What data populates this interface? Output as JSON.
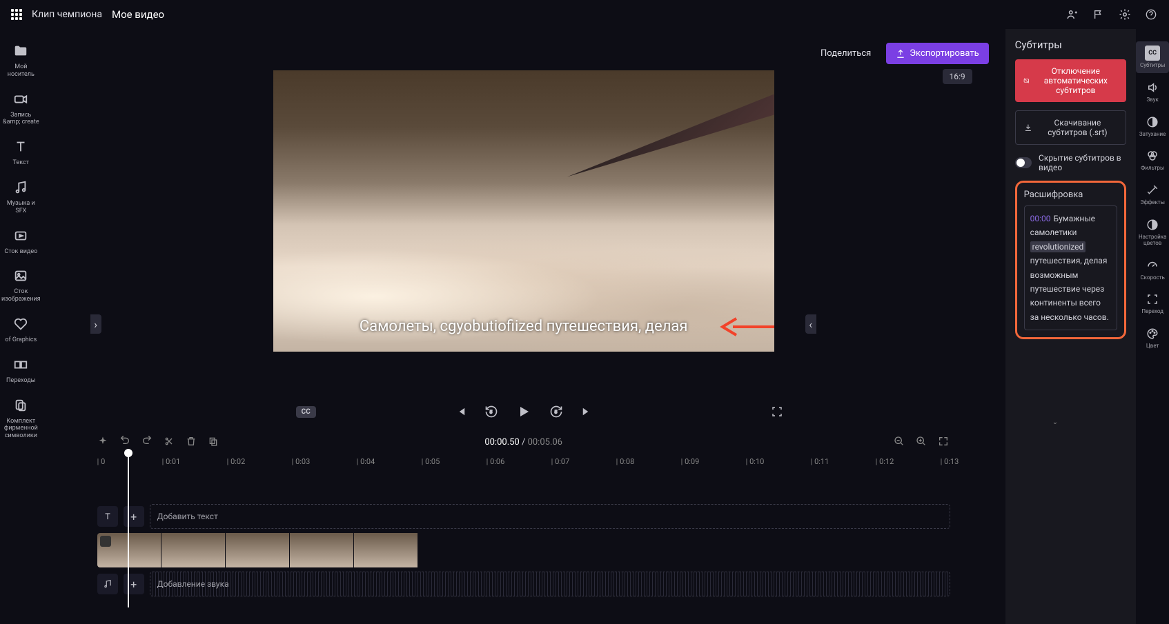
{
  "header": {
    "brand": "Клип чемпиона",
    "project": "Мое видео"
  },
  "left_rail": [
    {
      "label": "Мой носитель"
    },
    {
      "label": "Запись &amp; create"
    },
    {
      "label": "Текст"
    },
    {
      "label": "Музыка и SFX"
    },
    {
      "label": "Сток видео"
    },
    {
      "label": "Сток изображения"
    },
    {
      "label": "of Graphics"
    },
    {
      "label": "Переходы"
    },
    {
      "label": "Комплект фирменной символики"
    }
  ],
  "stage": {
    "share": "Поделиться",
    "export": "Экспортировать",
    "aspect": "16:9",
    "subtitle": "Самолеты, cgyobutiofiized путешествия, делая",
    "cc": "CC"
  },
  "timecode": {
    "current": "00:00.50",
    "duration": "00:05.06"
  },
  "ruler": [
    "0",
    "0:01",
    "0:02",
    "0:03",
    "0:04",
    "0:05",
    "0:06",
    "0:07",
    "0:08",
    "0:09",
    "0:10",
    "0:11",
    "0:12",
    "0:13"
  ],
  "tracks": {
    "add_text": "Добавить текст",
    "add_audio": "Добавление звука"
  },
  "panel": {
    "title": "Субтитры",
    "disable": "Отключение автоматических субтитров",
    "download": "Скачивание субтитров (.srt)",
    "hide": "Скрытие субтитров в видео",
    "transcript_title": "Расшифровка",
    "transcript": {
      "ts": "00:00",
      "text_before": "Бумажные самолетики ",
      "highlight": "revolutionized",
      "text_after": " путешествия, делая возможным путешествие через континенты всего за несколько часов."
    }
  },
  "right_rail": [
    {
      "label": "Субтитры",
      "badge": "CC"
    },
    {
      "label": "Звук"
    },
    {
      "label": "Затухание"
    },
    {
      "label": "Фильтры"
    },
    {
      "label": "Эффекты"
    },
    {
      "label": "Настройка цветов"
    },
    {
      "label": "Скорость"
    },
    {
      "label": "Переход"
    },
    {
      "label": "Цвет"
    }
  ]
}
